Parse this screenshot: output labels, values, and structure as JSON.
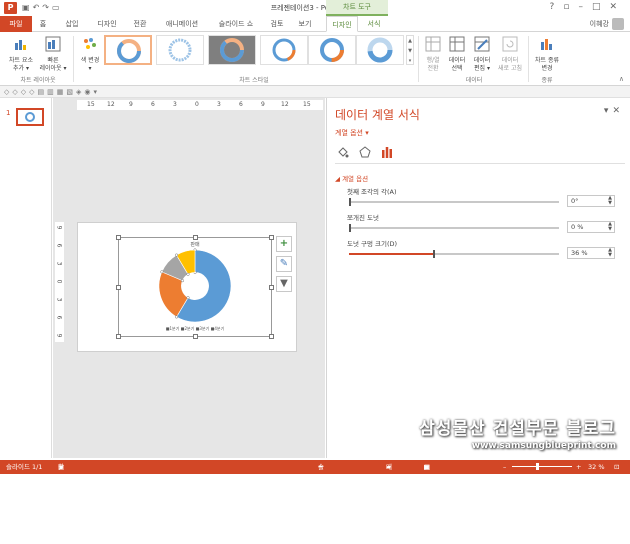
{
  "titlebar": {
    "title": "프레젠테이션3 - PowerPoint",
    "logo_text": "P",
    "contextual_group": "차트 도구",
    "qat_icons": [
      "save-icon",
      "undo-icon",
      "redo-icon",
      "start-icon"
    ],
    "window_buttons": [
      "help-icon",
      "restore-icon",
      "minimize-icon",
      "maximize-icon",
      "close-icon"
    ]
  },
  "tabs": [
    {
      "label": "파일",
      "kind": "file"
    },
    {
      "label": "홈"
    },
    {
      "label": "삽입"
    },
    {
      "label": "디자인"
    },
    {
      "label": "전환"
    },
    {
      "label": "애니메이션"
    },
    {
      "label": "슬라이드 쇼"
    },
    {
      "label": "검토"
    },
    {
      "label": "보기"
    },
    {
      "label": "디자인",
      "active": true
    },
    {
      "label": "서식"
    }
  ],
  "user": {
    "name": "이혜강"
  },
  "ribbon": {
    "add_element": "차트 요소\n추가 ▾",
    "quick_layout": "빠른\n레이아웃 ▾",
    "change_color": "색 변경\n▾",
    "group_layouts": "차트 레이아웃",
    "group_styles": "차트 스타일",
    "switch_row_col": "행/열\n전환",
    "select_data": "데이터\n선택",
    "edit_data": "데이터\n편집 ▾",
    "refresh_data": "데이터\n새로 고침",
    "group_data": "데이터",
    "change_type": "차트 종류\n변경",
    "group_type": "종류"
  },
  "slides": [
    {
      "number": "1"
    }
  ],
  "ruler": {
    "h_ticks": [
      "15",
      "12",
      "9",
      "6",
      "3",
      "0",
      "3",
      "6",
      "9",
      "12",
      "15"
    ],
    "v_ticks": [
      "9",
      "6",
      "3",
      "0",
      "3",
      "6",
      "9"
    ]
  },
  "chart": {
    "title": "판매",
    "legend": "■1분기 ■2분기 ■3분기 ■4분기"
  },
  "chart_data": {
    "type": "pie",
    "title": "판매",
    "categories": [
      "1분기",
      "2분기",
      "3분기",
      "4분기"
    ],
    "values": [
      8.2,
      3.2,
      1.4,
      1.2
    ],
    "colors": [
      "#5b9bd5",
      "#ed7d31",
      "#a5a5a5",
      "#ffc000"
    ],
    "hole_size_percent": 36,
    "first_slice_angle": 0,
    "explosion_percent": 0
  },
  "pane": {
    "title": "데이터 계열 서식",
    "series_options_dropdown": "계열 옵션 ▾",
    "section": "계열 옵션",
    "first_slice_angle_label": "첫째 조각의 각(A)",
    "first_slice_angle_value": "0°",
    "explosion_label": "쪼개진 도넛",
    "explosion_value": "0 %",
    "hole_size_label": "도넛 구멍 크기(D)",
    "hole_size_value": "36 %"
  },
  "status": {
    "slide": "슬라이드 1/1",
    "language": "한국어",
    "notes": "슬라이드 노트",
    "comments": "메모",
    "zoom": "32 %"
  },
  "watermark": {
    "line1": "삼성물산 건설부문 블로그",
    "line2": "www.samsungblueprint.com"
  }
}
